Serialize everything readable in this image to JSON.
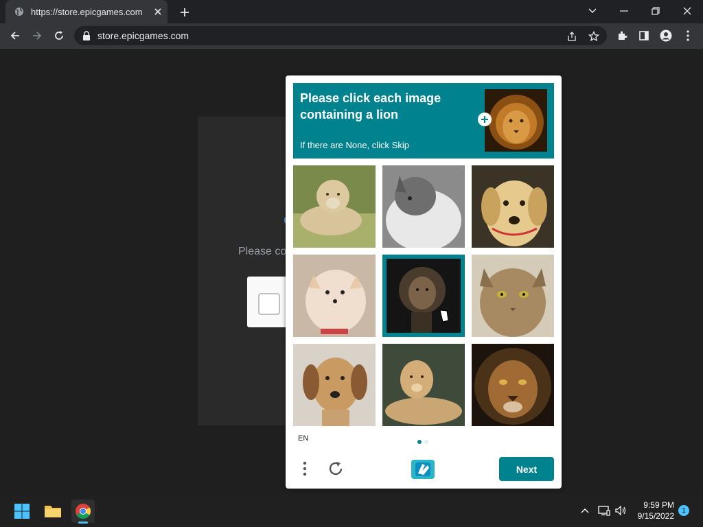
{
  "browser": {
    "tab_title": "https://store.epicgames.com",
    "url": "store.epicgames.com"
  },
  "page": {
    "behind_text": "Please co"
  },
  "captcha": {
    "prompt_title": "Please click each image containing a lion",
    "prompt_sub": "If there are None, click Skip",
    "sample_image": "lion",
    "images": [
      {
        "subject": "lioness",
        "selected": false
      },
      {
        "subject": "cat",
        "selected": false
      },
      {
        "subject": "dog",
        "selected": false
      },
      {
        "subject": "dog",
        "selected": false
      },
      {
        "subject": "lion",
        "selected": true
      },
      {
        "subject": "cat",
        "selected": false
      },
      {
        "subject": "dog",
        "selected": false
      },
      {
        "subject": "lioness",
        "selected": false
      },
      {
        "subject": "lion",
        "selected": false
      }
    ],
    "language": "EN",
    "page_indicator": {
      "current": 1,
      "total": 2
    },
    "next_label": "Next"
  },
  "taskbar": {
    "time": "9:59 PM",
    "date": "9/15/2022",
    "notification_count": "1"
  },
  "colors": {
    "accent": "#00838f",
    "chrome_dark": "#202124",
    "chrome_toolbar": "#35363a"
  }
}
